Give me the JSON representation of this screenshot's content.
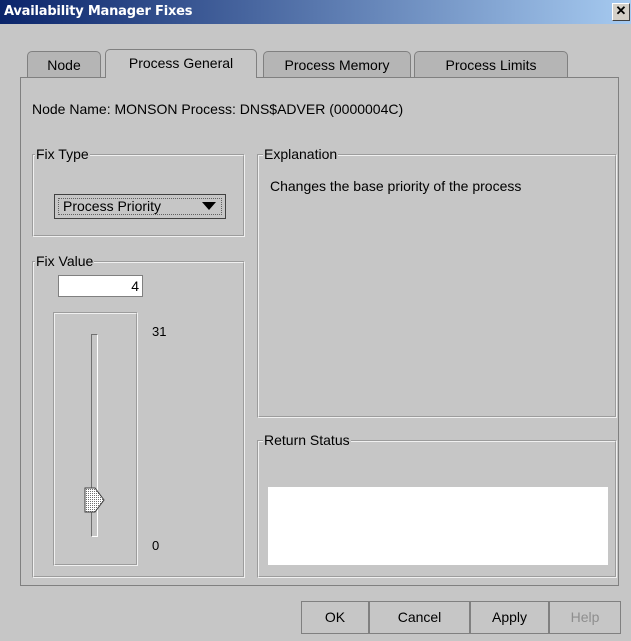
{
  "window": {
    "title": "Availability Manager Fixes",
    "close_glyph": "✕"
  },
  "tabs": [
    {
      "label": "Node",
      "active": false
    },
    {
      "label": "Process General",
      "active": true
    },
    {
      "label": "Process Memory",
      "active": false
    },
    {
      "label": "Process Limits",
      "active": false
    }
  ],
  "header": {
    "node_label": "Node Name:",
    "node_value": "MONSON",
    "process_label": "Process:",
    "process_value": "DNS$ADVER (0000004C)"
  },
  "fix_type": {
    "legend": "Fix Type",
    "selected": "Process Priority"
  },
  "fix_value": {
    "legend": "Fix Value",
    "value": "4",
    "slider_max": "31",
    "slider_min": "0",
    "slider_level": 4
  },
  "explanation": {
    "legend": "Explanation",
    "text": "Changes the base priority of the process"
  },
  "return_status": {
    "legend": "Return Status",
    "text": ""
  },
  "buttons": {
    "ok": "OK",
    "cancel": "Cancel",
    "apply": "Apply",
    "help": "Help"
  }
}
